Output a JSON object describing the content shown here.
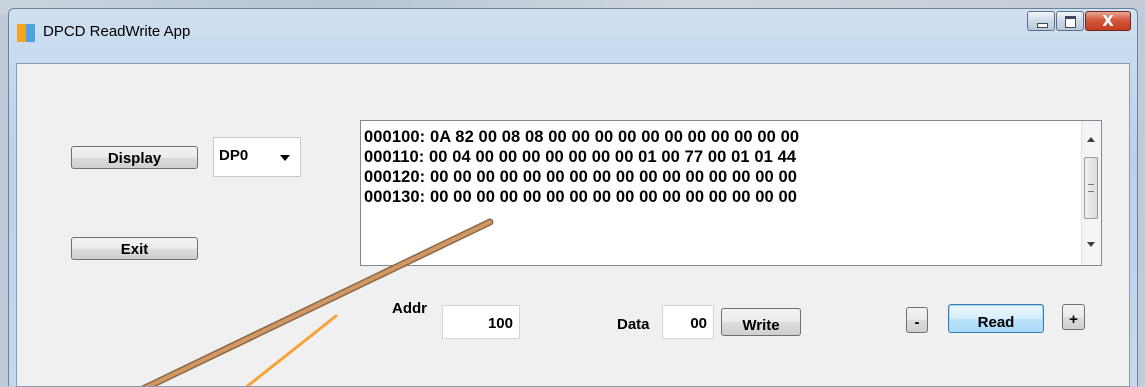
{
  "window": {
    "title": "DPCD ReadWrite App",
    "close_glyph": "X"
  },
  "left_panel": {
    "display_label": "Display",
    "exit_label": "Exit",
    "port_selected": "DP0"
  },
  "dump": {
    "lines": [
      "000100: 0A 82 00 08 08 00 00 00 00 00 00 00 00 00 00 00",
      "000110: 00 04 00 00 00 00 00 00 00 01 00 77 00 01 01 44",
      "000120: 00 00 00 00 00 00 00 00 00 00 00 00 00 00 00 00",
      "000130: 00 00 00 00 00 00 00 00 00 00 00 00 00 00 00 00"
    ]
  },
  "bottom": {
    "addr_label": "Addr",
    "addr_value": "100",
    "data_label": "Data",
    "data_value": "00",
    "write_label": "Write",
    "minus_label": "-",
    "read_label": "Read",
    "plus_label": "+"
  },
  "colors": {
    "title_icon_left": "#f2a524",
    "title_icon_right": "#4aa3df",
    "arrow": "#c98a5a",
    "close_button": "#c94a31"
  },
  "icons": [
    "app-icon",
    "minimize-icon",
    "maximize-icon",
    "close-icon",
    "dropdown-arrow-icon",
    "scroll-up-icon",
    "scroll-down-icon"
  ]
}
